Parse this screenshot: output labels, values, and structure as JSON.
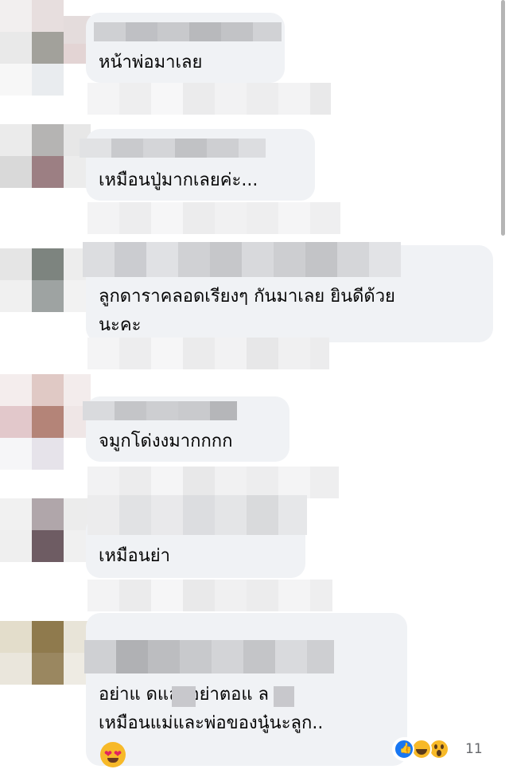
{
  "comments": [
    {
      "text_lines": [
        "หน้าพ่อมาเลย"
      ]
    },
    {
      "text_lines": [
        "เหมือนปู่มากเลยค่ะ..."
      ]
    },
    {
      "text_lines": [
        "ลูกดาราคลอดเรียงๆ กันมาเลย ยินดีด้วย",
        "นะคะ"
      ]
    },
    {
      "text_lines": [
        "จมูกโด่งงมากกกก"
      ]
    },
    {
      "text_lines": [
        "เหมือนย่า"
      ]
    },
    {
      "text_lines": [
        "อย่าแ   ดและอย่าตอแ   ล",
        "เหมือนแม่และพ่อของนู๋นะลูก.."
      ]
    }
  ],
  "reactions": {
    "icons": [
      "like-icon",
      "laugh-icon",
      "wow-icon"
    ],
    "count": "11"
  },
  "emoji": "heart-eyes-icon",
  "colors": {
    "bubble": "#f0f2f5",
    "text": "#050505",
    "like": "#1877f2",
    "reaction_yellow": "#f7b928"
  }
}
